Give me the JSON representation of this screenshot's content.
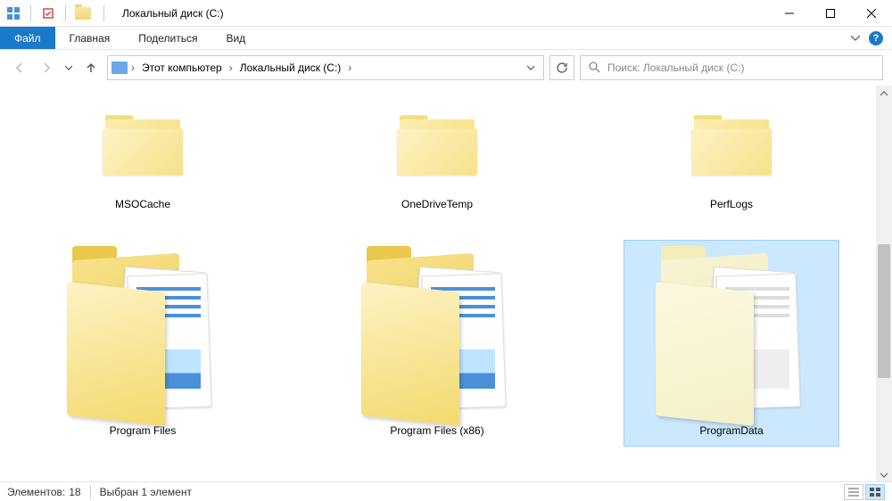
{
  "title": "Локальный диск (C:)",
  "ribbon": {
    "file": "Файл",
    "home": "Главная",
    "share": "Поделиться",
    "view": "Вид"
  },
  "breadcrumb": {
    "root": "Этот компьютер",
    "current": "Локальный диск (C:)"
  },
  "search": {
    "placeholder": "Поиск: Локальный диск (C:)"
  },
  "folders": [
    {
      "name": "MSOCache",
      "type": "empty",
      "selected": false
    },
    {
      "name": "OneDriveTemp",
      "type": "empty",
      "selected": false
    },
    {
      "name": "PerfLogs",
      "type": "empty",
      "selected": false
    },
    {
      "name": "Program Files",
      "type": "docs",
      "selected": false
    },
    {
      "name": "Program Files (x86)",
      "type": "docs",
      "selected": false
    },
    {
      "name": "ProgramData",
      "type": "docs-light",
      "selected": true
    }
  ],
  "status": {
    "count_label": "Элементов:",
    "count": "18",
    "selection": "Выбран 1 элемент"
  }
}
